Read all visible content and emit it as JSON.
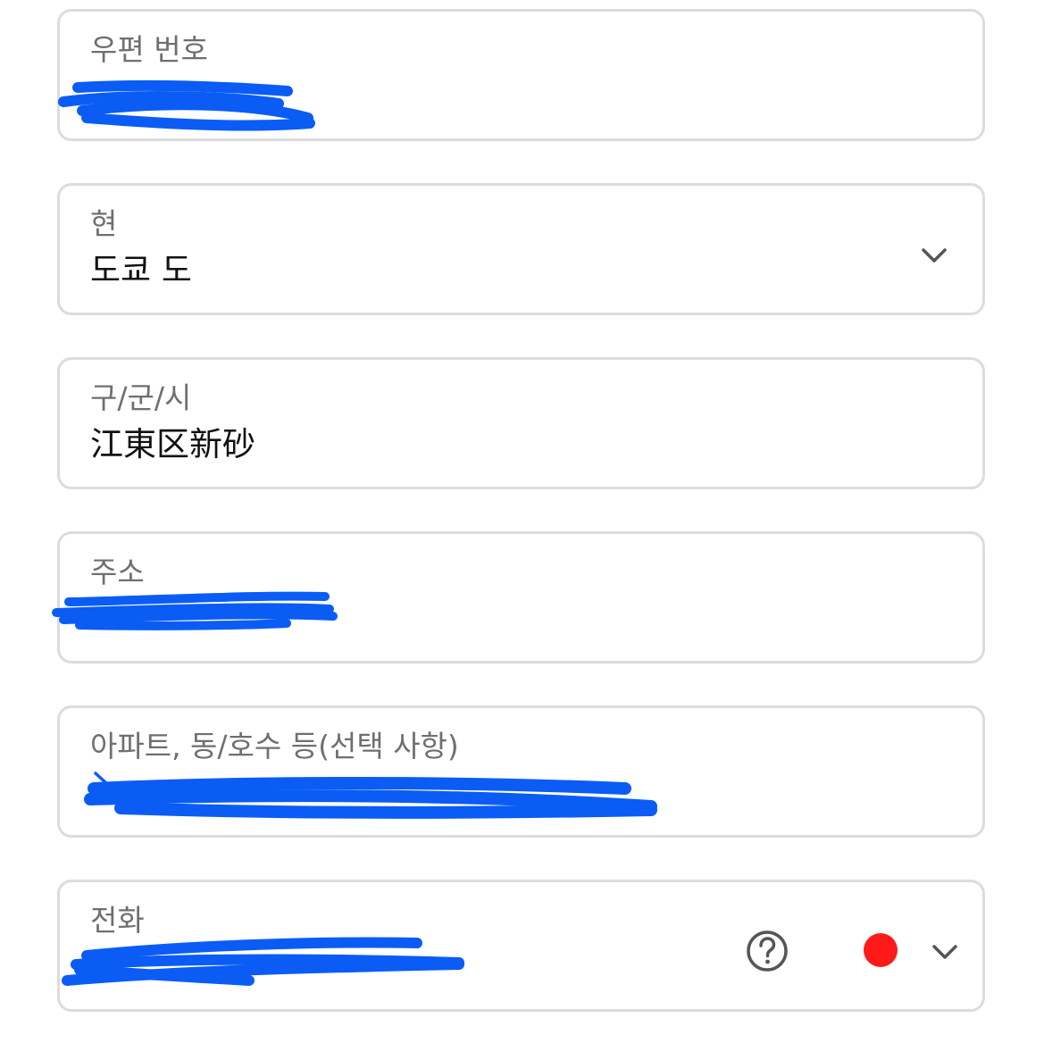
{
  "colors": {
    "border": "#dcdcdc",
    "label": "#6f6f6f",
    "value": "#111111",
    "redaction": "#0a5cf5",
    "flag": "#ff1a1a",
    "icon": "#555555"
  },
  "postal_code": {
    "label": "우편 번호",
    "value_redacted": true
  },
  "prefecture": {
    "label": "현",
    "value": "도쿄 도",
    "icon": "chevron-down-icon"
  },
  "city": {
    "label": "구/군/시",
    "value": "江東区新砂"
  },
  "address": {
    "label": "주소",
    "value_redacted": true
  },
  "apartment": {
    "label": "아파트, 동/호수 등(선택 사항)",
    "value_redacted": true
  },
  "phone": {
    "label": "전화",
    "value_redacted": true,
    "help_icon": "help-circle-icon",
    "country_icon": "country-flag-icon",
    "dropdown_icon": "chevron-down-icon"
  }
}
